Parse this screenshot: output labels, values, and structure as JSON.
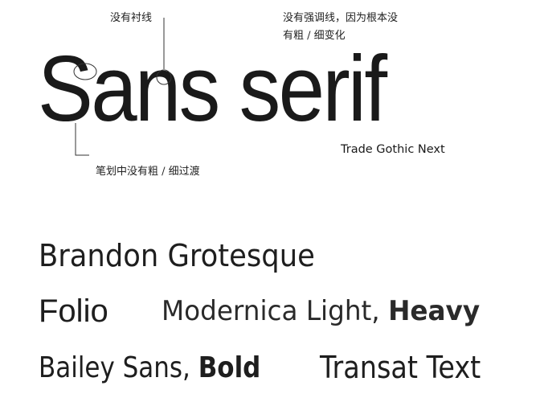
{
  "hero": {
    "title": "Sans serif",
    "font_name": "Trade Gothic Next"
  },
  "annotations": {
    "no_serifs": "没有衬线",
    "no_contrast_line1": "没有强调线，因为根本没",
    "no_contrast_line2": "有粗 / 细变化",
    "no_stroke_variation": "笔划中没有粗 / 细过渡"
  },
  "samples": {
    "brandon": "Brandon Grotesque",
    "folio": "Folio",
    "modernica_light": "Modernica Light,",
    "modernica_heavy": "Heavy",
    "bailey_regular": "Bailey Sans,",
    "bailey_bold": "Bold",
    "transat": "Transat Text"
  }
}
